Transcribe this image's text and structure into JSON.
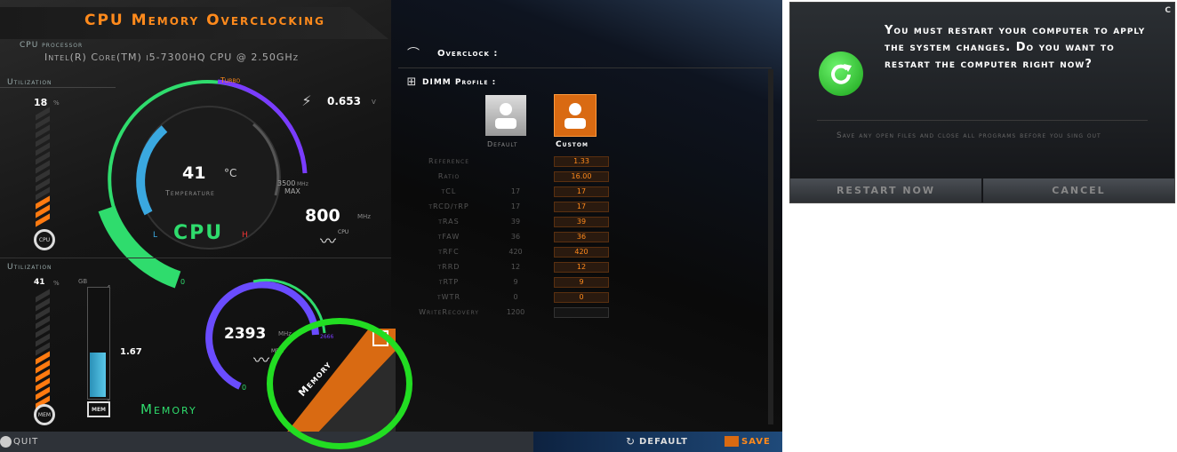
{
  "app": {
    "title": "CPU Memory Overclocking",
    "cpu_processor_label": "CPU processor",
    "cpu_processor_name": "Intel(R) Core(TM) i5-7300HQ CPU @ 2.50GHz",
    "cpu": {
      "utilization_label": "Utilization",
      "utilization_value": "18",
      "utilization_unit": "%",
      "voltage": "0.653",
      "voltage_unit": "V",
      "turbo_label": "Turbo",
      "max_value": "3500",
      "max_unit": "MHz",
      "max_label": "MAX",
      "temperature": "41",
      "temperature_unit": "°C",
      "temperature_label": "Temperature",
      "gauge_low": "L",
      "gauge_high": "H",
      "name_label": "CPU",
      "frequency": "800",
      "frequency_unit": "MHz",
      "freq_icon_label": "CPU",
      "zero_label": "0",
      "fan_label": "CPU"
    },
    "memory": {
      "utilization_label": "Utilization",
      "utilization_value": "41",
      "utilization_unit": "%",
      "gb_label": "GB",
      "scale_max": "4",
      "scale_min": "0",
      "used_value": "1.67",
      "chip_label": "MEM",
      "name_label": "Memory",
      "frequency": "2393",
      "frequency_unit": "MHz",
      "freq_icon_label": "MEM",
      "gauge_max": "2666",
      "zero_label": "0",
      "fan_label": "MEM",
      "tab_label": "Memory"
    },
    "overclock_label": "Overclock :",
    "dimm_profile_label": "DIMM Profile :",
    "profile_default_label": "Default",
    "profile_custom_label": "Custom",
    "table_rows": [
      {
        "label": "Reference",
        "default": "",
        "custom": "1.33"
      },
      {
        "label": "Ratio",
        "default": "",
        "custom": "16.00"
      },
      {
        "label": "tCL",
        "default": "17",
        "custom": "17"
      },
      {
        "label": "tRCD/tRP",
        "default": "17",
        "custom": "17"
      },
      {
        "label": "tRAS",
        "default": "39",
        "custom": "39"
      },
      {
        "label": "tFAW",
        "default": "36",
        "custom": "36"
      },
      {
        "label": "tRFC",
        "default": "420",
        "custom": "420"
      },
      {
        "label": "tRRD",
        "default": "12",
        "custom": "12"
      },
      {
        "label": "tRTP",
        "default": "9",
        "custom": "9"
      },
      {
        "label": "tWTR",
        "default": "0",
        "custom": "0"
      },
      {
        "label": "WriteRecovery",
        "default": "1200",
        "custom": ""
      }
    ],
    "quit_label": "QUIT",
    "default_button_label": "DEFAULT",
    "save_button_label": "SAVE"
  },
  "dialog": {
    "message": "You must restart your computer to apply the system changes. Do you want to restart the computer right now?",
    "note": "Save any open files and close all programs before you sing out",
    "restart_label": "RESTART NOW",
    "cancel_label": "CANCEL",
    "corner_label": "C"
  },
  "colors": {
    "accent_orange": "#ff8a1c",
    "accent_green": "#2fdc6d",
    "highlight_circle": "#22dd22",
    "gauge_blue": "#3aa8e0",
    "gauge_purple": "#7a3cff"
  }
}
